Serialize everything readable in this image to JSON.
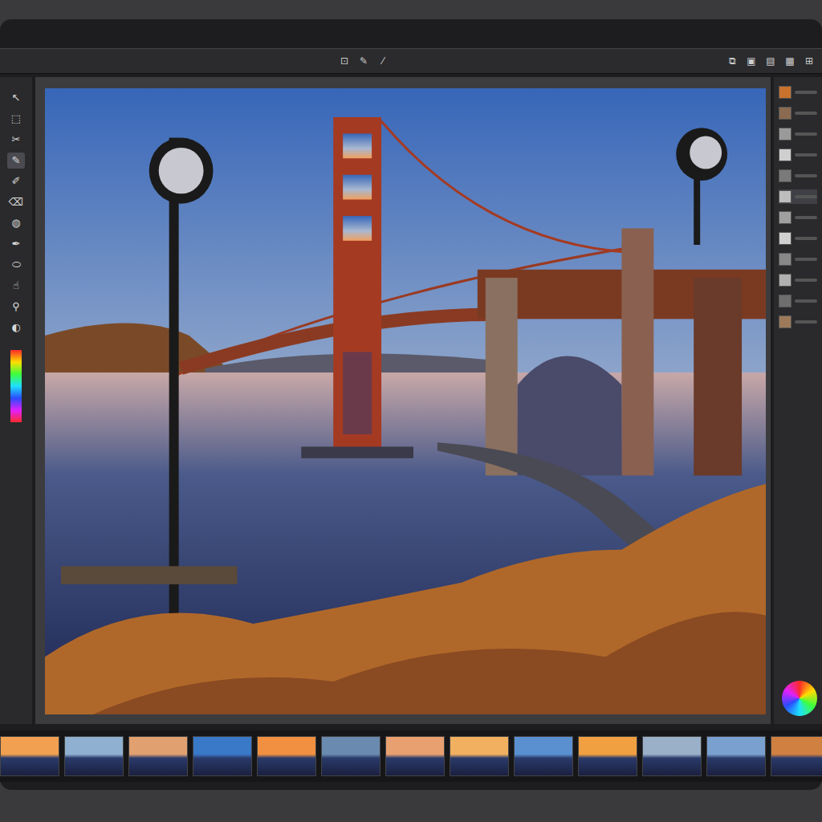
{
  "toolbar": {
    "center_icons": [
      "⊡",
      "✎",
      "⁄"
    ],
    "right_icons": [
      "⧉",
      "▣",
      "▤",
      "▦",
      "⊞"
    ]
  },
  "tools": [
    {
      "icon": "↖",
      "selected": false
    },
    {
      "icon": "⬚",
      "selected": false
    },
    {
      "icon": "✂",
      "selected": false
    },
    {
      "icon": "✎",
      "selected": true
    },
    {
      "icon": "✐",
      "selected": false
    },
    {
      "icon": "⌫",
      "selected": false
    },
    {
      "icon": "◍",
      "selected": false
    },
    {
      "icon": "✒",
      "selected": false
    },
    {
      "icon": "⬭",
      "selected": false
    },
    {
      "icon": "☝",
      "selected": false
    },
    {
      "icon": "⚲",
      "selected": false
    },
    {
      "icon": "◐",
      "selected": false
    }
  ],
  "panel_rows": [
    {
      "color": "#c8722e",
      "selected": false
    },
    {
      "color": "#8a6a50",
      "selected": false
    },
    {
      "color": "#9a9a9a",
      "selected": false
    },
    {
      "color": "#cfcfcf",
      "selected": false
    },
    {
      "color": "#7a7a7a",
      "selected": false
    },
    {
      "color": "#bdbdbd",
      "selected": true
    },
    {
      "color": "#a0a0a0",
      "selected": false
    },
    {
      "color": "#d0d0d0",
      "selected": false
    },
    {
      "color": "#888888",
      "selected": false
    },
    {
      "color": "#b0b0b0",
      "selected": false
    },
    {
      "color": "#6e6e6e",
      "selected": false
    },
    {
      "color": "#9c7a5a",
      "selected": false
    }
  ],
  "filmstrip": [
    {
      "color": "#f0a050",
      "selected": false
    },
    {
      "color": "#8fb0d0",
      "selected": false
    },
    {
      "color": "#e0a070",
      "selected": false
    },
    {
      "color": "#3a78c8",
      "selected": false
    },
    {
      "color": "#f09040",
      "selected": false
    },
    {
      "color": "#6a8ab0",
      "selected": false
    },
    {
      "color": "#e8a070",
      "selected": false
    },
    {
      "color": "#f0b060",
      "selected": false
    },
    {
      "color": "#5a90d0",
      "selected": false
    },
    {
      "color": "#f0a040",
      "selected": false
    },
    {
      "color": "#9ab0c8",
      "selected": false
    },
    {
      "color": "#7aa0d0",
      "selected": false
    },
    {
      "color": "#d08040",
      "selected": false
    }
  ]
}
